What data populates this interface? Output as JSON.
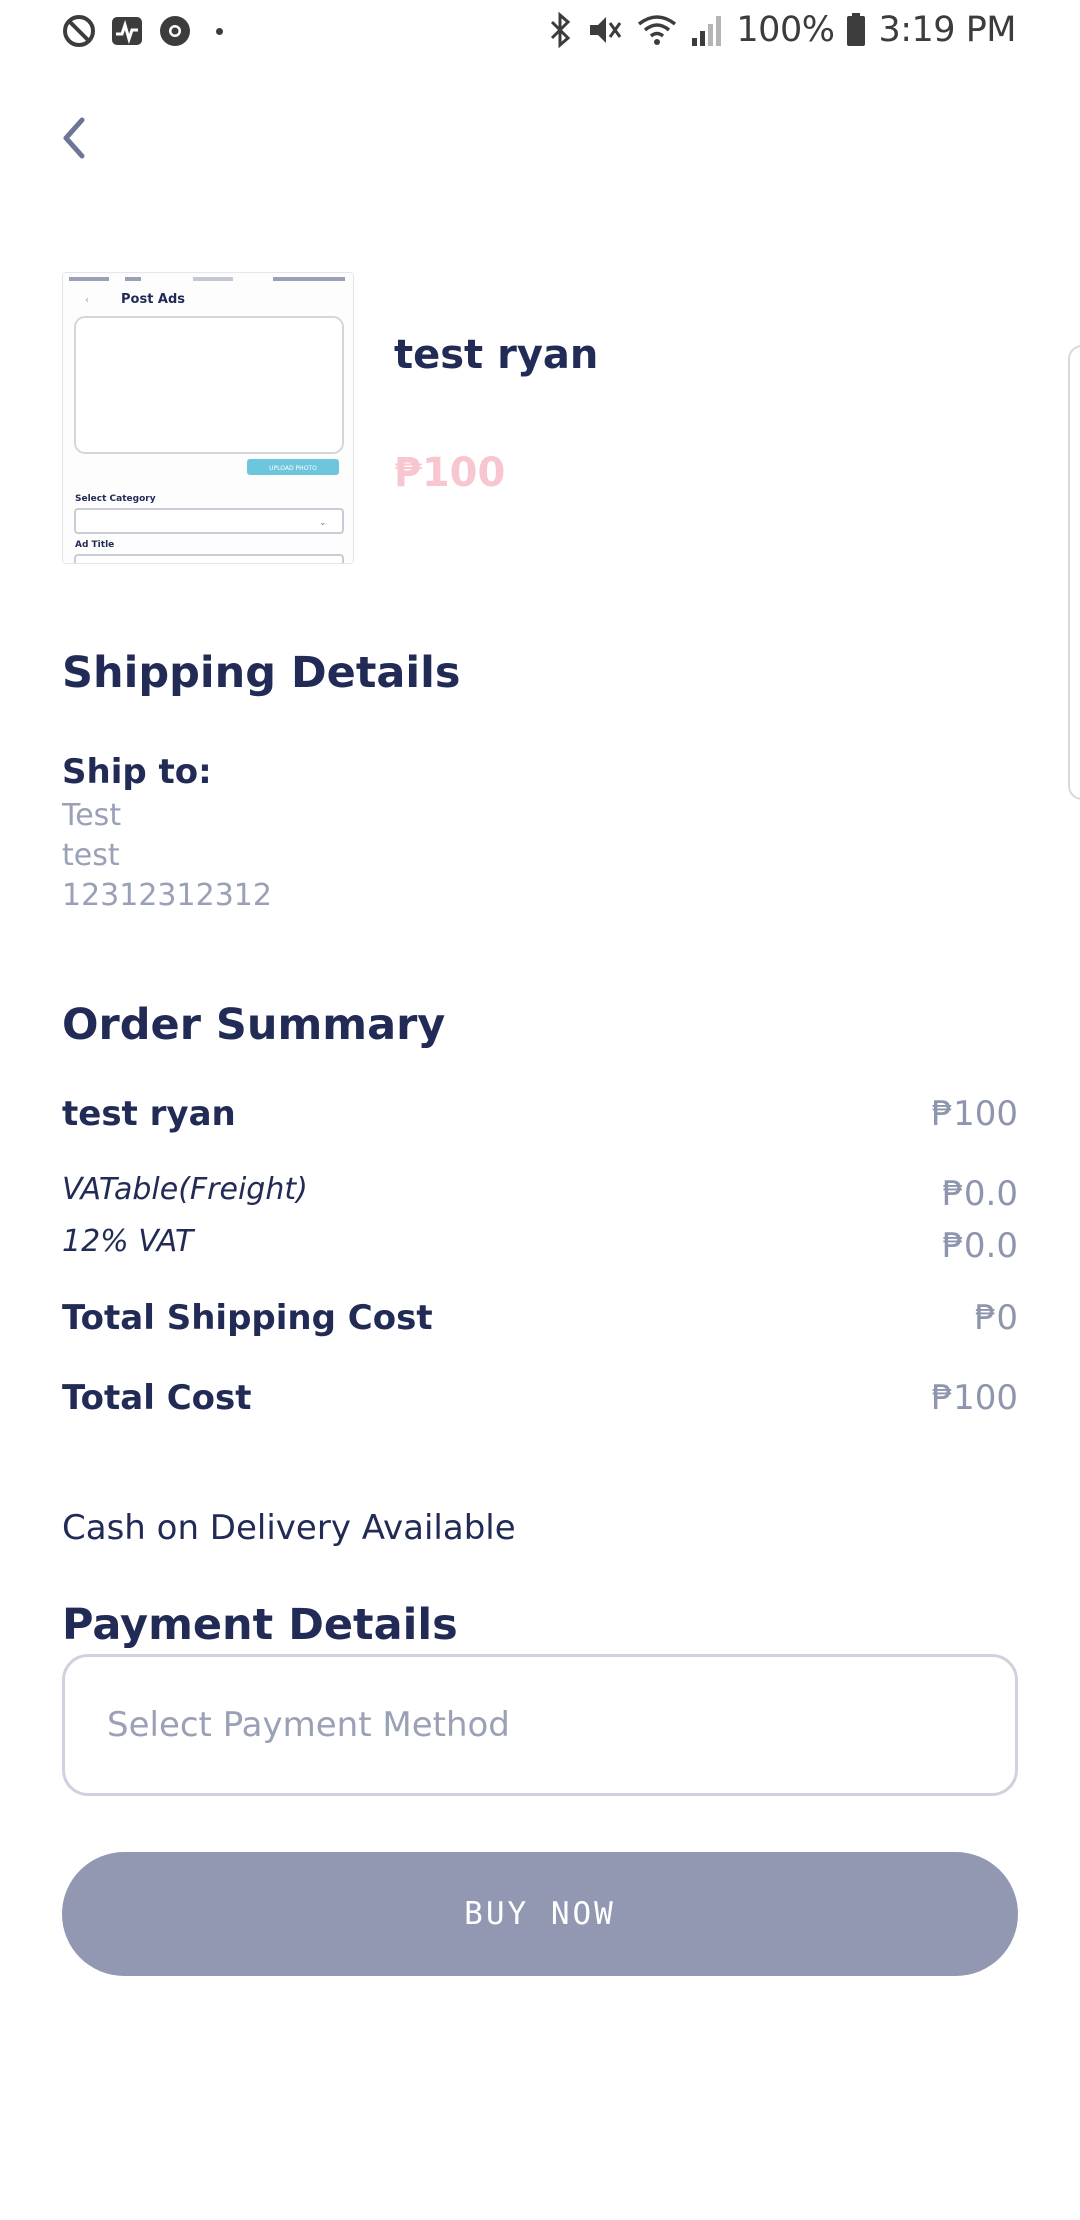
{
  "status_bar": {
    "battery": "100%",
    "time": "3:19 PM",
    "left_icons": [
      "no-sync-icon",
      "health-monitor-icon",
      "chrome-icon",
      "notification-dot-icon"
    ],
    "right_icons": [
      "bluetooth-icon",
      "vibrate-mute-icon",
      "wifi-icon",
      "signal-icon",
      "battery-icon"
    ]
  },
  "header": {
    "back_icon": "chevron-left-icon"
  },
  "product": {
    "title": "test ryan",
    "price": "₱100",
    "thumbnail": {
      "header": "Post Ads",
      "button": "UPLOAD PHOTO",
      "label1": "Select Category",
      "label2": "Ad Title"
    }
  },
  "shipping": {
    "title": "Shipping Details",
    "ship_to_label": "Ship to:",
    "lines": [
      "Test",
      "test",
      "12312312312"
    ]
  },
  "order_summary": {
    "title": "Order Summary",
    "item_name": "test ryan",
    "item_price": "₱100",
    "vatable_label": "VATable(Freight)",
    "vatable_value": "₱0.0",
    "vat_label": "12% VAT",
    "vat_value": "₱0.0",
    "shipping_cost_label": "Total Shipping Cost",
    "shipping_cost_value": "₱0",
    "total_label": "Total Cost",
    "total_value": "₱100"
  },
  "cod_text": "Cash on Delivery Available",
  "payment": {
    "title": "Payment Details",
    "placeholder": "Select Payment Method"
  },
  "buy_button": "BUY NOW",
  "colors": {
    "navy": "#212b55",
    "muted": "#9aa0b6",
    "price_pink": "#f7c6cf",
    "button": "#9298b1"
  }
}
